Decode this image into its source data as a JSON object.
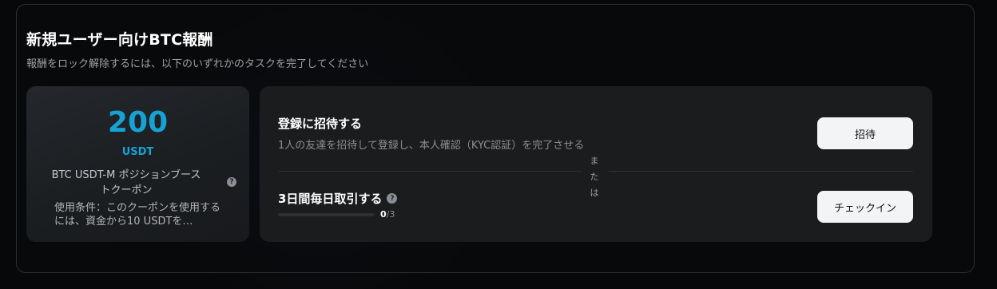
{
  "header": {
    "title": "新規ユーザー向けBTC報酬",
    "subtitle": "報酬をロック解除するには、以下のいずれかのタスクを完了してください"
  },
  "coupon": {
    "amount": "200",
    "unit": "USDT",
    "name": "BTC USDT-M ポジションブーストクーポン",
    "info_icon": "?",
    "condition": "使用条件：このクーポンを使用するには、資金から10 USDTを…"
  },
  "tasks": {
    "invite": {
      "title": "登録に招待する",
      "description": "1人の友達を招待して登録し、本人確認（KYC認証）を完了させる",
      "button_label": "招待"
    },
    "or_label": "または",
    "checkin": {
      "title": "3日間毎日取引する",
      "info_icon": "?",
      "progress_current": "0",
      "progress_total": "/3",
      "progress_fraction": 0,
      "button_label": "チェックイン"
    }
  },
  "colors": {
    "accent": "#17a2d6",
    "background": "#070809",
    "card": "#1a1c1e",
    "button": "#f3f4f5"
  }
}
